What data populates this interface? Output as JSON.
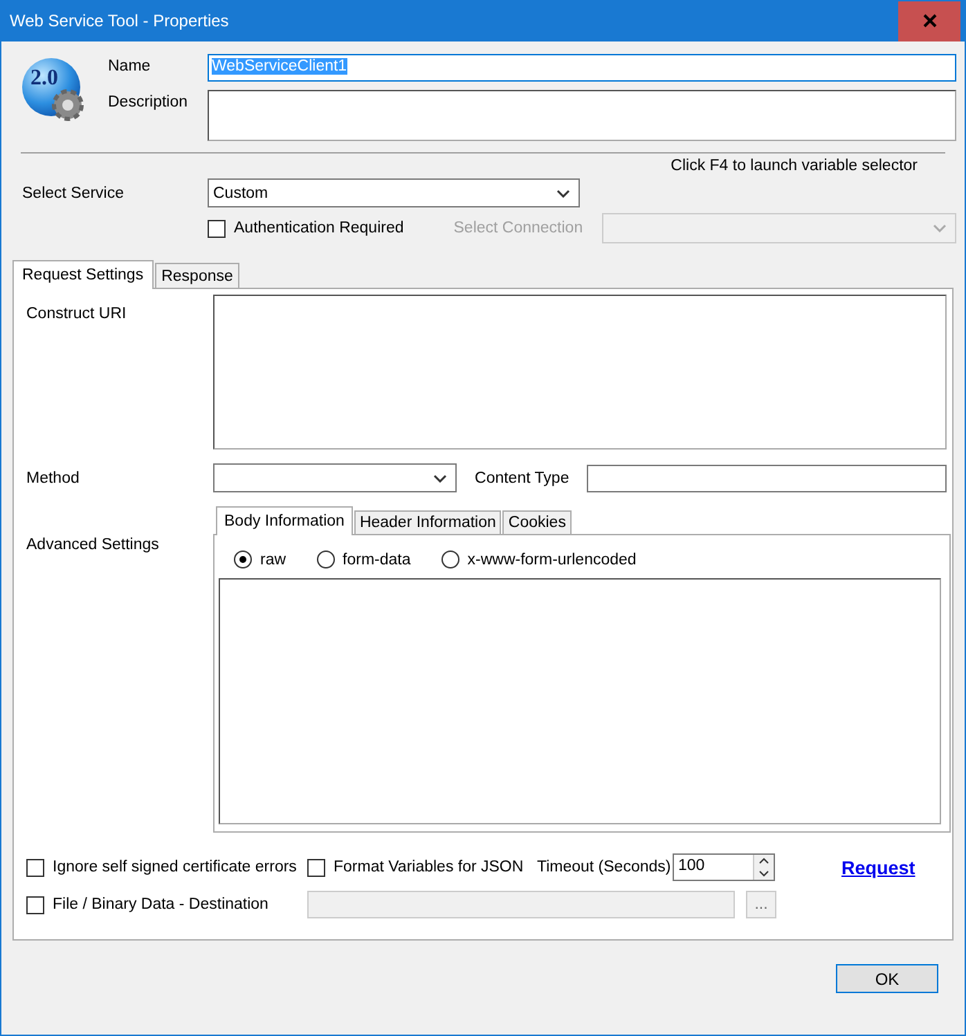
{
  "window": {
    "title": "Web Service Tool - Properties"
  },
  "logo": {
    "text": "2.0"
  },
  "name": {
    "label": "Name",
    "value": "WebServiceClient1",
    "selected": true
  },
  "description": {
    "label": "Description"
  },
  "hint": "Click F4 to launch variable selector",
  "service": {
    "label": "Select Service",
    "value": "Custom"
  },
  "authentication": {
    "label": "Authentication Required",
    "checked": false
  },
  "connection": {
    "label": "Select Connection",
    "disabled": true
  },
  "tabs": [
    {
      "label": "Request Settings",
      "selected": true
    },
    {
      "label": "Response",
      "selected": false
    }
  ],
  "construct_uri": {
    "label": "Construct URI"
  },
  "method": {
    "label": "Method"
  },
  "content_type": {
    "label": "Content Type"
  },
  "advanced": {
    "label": "Advanced Settings",
    "tabs": [
      {
        "label": "Body Information",
        "selected": true
      },
      {
        "label": "Header Information",
        "selected": false
      },
      {
        "label": "Cookies",
        "selected": false
      }
    ],
    "body_modes": [
      {
        "label": "raw",
        "selected": true
      },
      {
        "label": "form-data",
        "selected": false
      },
      {
        "label": "x-www-form-urlencoded",
        "selected": false
      }
    ]
  },
  "options": [
    {
      "label": "Ignore self signed certificate errors",
      "checked": false
    },
    {
      "label": "Format Variables for JSON",
      "checked": false
    }
  ],
  "timeout": {
    "label": "Timeout (Seconds)",
    "value": "100"
  },
  "request_link": "Request",
  "file_destination": {
    "label": "File / Binary Data - Destination",
    "checked": false,
    "disabled": true,
    "browse": "..."
  },
  "ok": "OK"
}
